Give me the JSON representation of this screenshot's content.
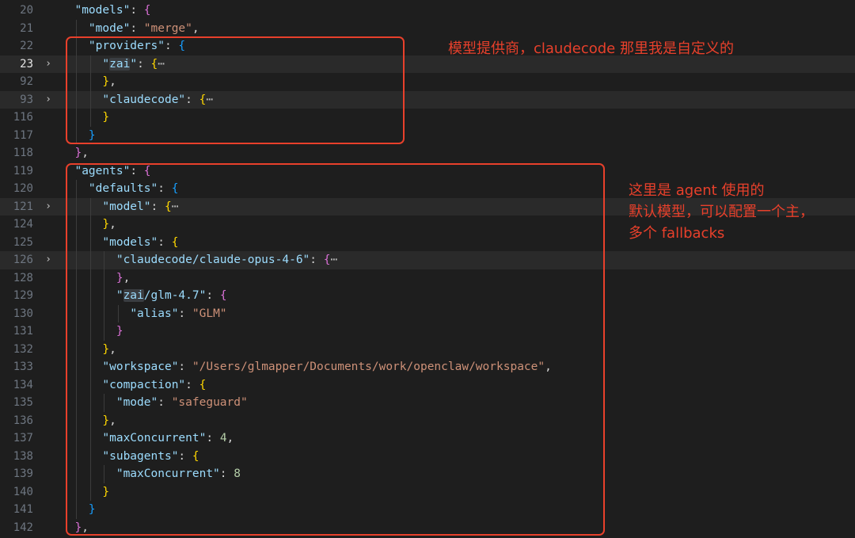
{
  "editor": {
    "lines": [
      {
        "ln": "20",
        "segs": [
          [
            "p",
            "  "
          ],
          [
            "k",
            "\"models\""
          ],
          [
            "p",
            ": "
          ],
          [
            "b2",
            "{"
          ]
        ]
      },
      {
        "ln": "21",
        "segs": [
          [
            "p",
            "    "
          ],
          [
            "k",
            "\"mode\""
          ],
          [
            "p",
            ": "
          ],
          [
            "s",
            "\"merge\""
          ],
          [
            "p",
            ","
          ]
        ]
      },
      {
        "ln": "22",
        "segs": [
          [
            "p",
            "    "
          ],
          [
            "k",
            "\"providers\""
          ],
          [
            "p",
            ": "
          ],
          [
            "b3",
            "{"
          ]
        ]
      },
      {
        "ln": "23",
        "active": true,
        "fold": true,
        "hl": true,
        "segs": [
          [
            "p",
            "      "
          ],
          [
            "k",
            "\""
          ],
          [
            "k sel",
            "zai"
          ],
          [
            "k",
            "\""
          ],
          [
            "p",
            ": "
          ],
          [
            "b1",
            "{"
          ],
          [
            "ell",
            "⋯"
          ]
        ]
      },
      {
        "ln": "92",
        "segs": [
          [
            "p",
            "      "
          ],
          [
            "b1",
            "}"
          ],
          [
            "p",
            ","
          ]
        ]
      },
      {
        "ln": "93",
        "fold": true,
        "hl": true,
        "segs": [
          [
            "p",
            "      "
          ],
          [
            "k",
            "\"claudecode\""
          ],
          [
            "p",
            ": "
          ],
          [
            "b1",
            "{"
          ],
          [
            "ell",
            "⋯"
          ]
        ]
      },
      {
        "ln": "116",
        "segs": [
          [
            "p",
            "      "
          ],
          [
            "b1",
            "}"
          ]
        ]
      },
      {
        "ln": "117",
        "segs": [
          [
            "p",
            "    "
          ],
          [
            "b3",
            "}"
          ]
        ]
      },
      {
        "ln": "118",
        "segs": [
          [
            "p",
            "  "
          ],
          [
            "b2",
            "}"
          ],
          [
            "p",
            ","
          ]
        ]
      },
      {
        "ln": "119",
        "segs": [
          [
            "p",
            "  "
          ],
          [
            "k",
            "\"agents\""
          ],
          [
            "p",
            ": "
          ],
          [
            "b2",
            "{"
          ]
        ]
      },
      {
        "ln": "120",
        "segs": [
          [
            "p",
            "    "
          ],
          [
            "k",
            "\"defaults\""
          ],
          [
            "p",
            ": "
          ],
          [
            "b3",
            "{"
          ]
        ]
      },
      {
        "ln": "121",
        "fold": true,
        "hl": true,
        "segs": [
          [
            "p",
            "      "
          ],
          [
            "k",
            "\"model\""
          ],
          [
            "p",
            ": "
          ],
          [
            "b1",
            "{"
          ],
          [
            "ell",
            "⋯"
          ]
        ]
      },
      {
        "ln": "124",
        "segs": [
          [
            "p",
            "      "
          ],
          [
            "b1",
            "}"
          ],
          [
            "p",
            ","
          ]
        ]
      },
      {
        "ln": "125",
        "segs": [
          [
            "p",
            "      "
          ],
          [
            "k",
            "\"models\""
          ],
          [
            "p",
            ": "
          ],
          [
            "b1",
            "{"
          ]
        ]
      },
      {
        "ln": "126",
        "fold": true,
        "hl": true,
        "segs": [
          [
            "p",
            "        "
          ],
          [
            "k",
            "\"claudecode/claude-opus-4-6\""
          ],
          [
            "p",
            ": "
          ],
          [
            "b2",
            "{"
          ],
          [
            "ell",
            "⋯"
          ]
        ]
      },
      {
        "ln": "128",
        "segs": [
          [
            "p",
            "        "
          ],
          [
            "b2",
            "}"
          ],
          [
            "p",
            ","
          ]
        ]
      },
      {
        "ln": "129",
        "segs": [
          [
            "p",
            "        "
          ],
          [
            "k",
            "\""
          ],
          [
            "k sel",
            "zai"
          ],
          [
            "k",
            "/glm-4.7\""
          ],
          [
            "p",
            ": "
          ],
          [
            "b2",
            "{"
          ]
        ]
      },
      {
        "ln": "130",
        "segs": [
          [
            "p",
            "          "
          ],
          [
            "k",
            "\"alias\""
          ],
          [
            "p",
            ": "
          ],
          [
            "s",
            "\"GLM\""
          ]
        ]
      },
      {
        "ln": "131",
        "segs": [
          [
            "p",
            "        "
          ],
          [
            "b2",
            "}"
          ]
        ]
      },
      {
        "ln": "132",
        "segs": [
          [
            "p",
            "      "
          ],
          [
            "b1",
            "}"
          ],
          [
            "p",
            ","
          ]
        ]
      },
      {
        "ln": "133",
        "segs": [
          [
            "p",
            "      "
          ],
          [
            "k",
            "\"workspace\""
          ],
          [
            "p",
            ": "
          ],
          [
            "s",
            "\"/Users/glmapper/Documents/work/openclaw/workspace\""
          ],
          [
            "p",
            ","
          ]
        ]
      },
      {
        "ln": "134",
        "segs": [
          [
            "p",
            "      "
          ],
          [
            "k",
            "\"compaction\""
          ],
          [
            "p",
            ": "
          ],
          [
            "b1",
            "{"
          ]
        ]
      },
      {
        "ln": "135",
        "segs": [
          [
            "p",
            "        "
          ],
          [
            "k",
            "\"mode\""
          ],
          [
            "p",
            ": "
          ],
          [
            "s",
            "\"safeguard\""
          ]
        ]
      },
      {
        "ln": "136",
        "segs": [
          [
            "p",
            "      "
          ],
          [
            "b1",
            "}"
          ],
          [
            "p",
            ","
          ]
        ]
      },
      {
        "ln": "137",
        "segs": [
          [
            "p",
            "      "
          ],
          [
            "k",
            "\"maxConcurrent\""
          ],
          [
            "p",
            ": "
          ],
          [
            "n",
            "4"
          ],
          [
            "p",
            ","
          ]
        ]
      },
      {
        "ln": "138",
        "segs": [
          [
            "p",
            "      "
          ],
          [
            "k",
            "\"subagents\""
          ],
          [
            "p",
            ": "
          ],
          [
            "b1",
            "{"
          ]
        ]
      },
      {
        "ln": "139",
        "segs": [
          [
            "p",
            "        "
          ],
          [
            "k",
            "\"maxConcurrent\""
          ],
          [
            "p",
            ": "
          ],
          [
            "n",
            "8"
          ]
        ]
      },
      {
        "ln": "140",
        "segs": [
          [
            "p",
            "      "
          ],
          [
            "b1",
            "}"
          ]
        ]
      },
      {
        "ln": "141",
        "segs": [
          [
            "p",
            "    "
          ],
          [
            "b3",
            "}"
          ]
        ]
      },
      {
        "ln": "142",
        "segs": [
          [
            "p",
            "  "
          ],
          [
            "b2",
            "}"
          ],
          [
            "p",
            ","
          ]
        ]
      }
    ]
  },
  "annotations": {
    "providers_note": "模型提供商，claudecode 那里我是自定义的",
    "agents_note_1": "这里是 agent 使用的",
    "agents_note_2": "默认模型，可以配置一个主，",
    "agents_note_3": "多个 fallbacks",
    "color": "#e8402b"
  }
}
